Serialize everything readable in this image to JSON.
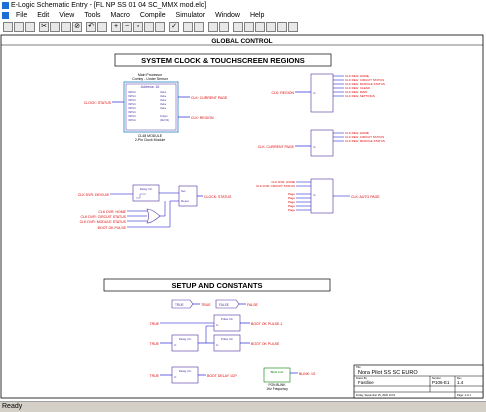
{
  "window": {
    "title": "E-Logic Schematic Entry - [FL NP SS 01 04 SC_MMX mod.elc]"
  },
  "menu": [
    "File",
    "Edit",
    "View",
    "Tools",
    "Macro",
    "Compile",
    "Simulator",
    "Window",
    "Help"
  ],
  "toolbar": {
    "buttons": [
      "new-icon",
      "open-icon",
      "save-icon",
      "cut-icon",
      "copy-icon",
      "paste-icon",
      "delete-icon",
      "undo-icon",
      "print-icon",
      "zoom-in-icon",
      "zoom-out-icon",
      "zoom-fit-icon",
      "window-icon",
      "copy-window-icon",
      "compile-icon",
      "wire-icon",
      "logic-icon",
      "symbol-icon",
      "pin-icon",
      "sim-icon",
      "probe-icon",
      "toggle-icon",
      "relay-icon",
      "gate-icon",
      "chart-icon"
    ]
  },
  "schematic": {
    "frame_title": "GLOBAL CONTROL",
    "section1_title": "SYSTEM CLOCK & TOUCHSCREEN REGIONS",
    "section2_title": "SETUP AND CONSTANTS",
    "clock_module": {
      "header1": "Main Processor",
      "header2": "Comby - Under Sensor",
      "address": "Address: 16",
      "caption1": "CL48 MODULE",
      "caption2": "2-Pin Clock Module"
    },
    "labels": {
      "clk_status": "CLOCK: STATUS",
      "clk_current_page": "CLK: CURRENT PAGE",
      "clk_region": "CLK: REGION",
      "clk_region_b": "CLK: REGION",
      "clk_current_page_b": "CLK: CURRENT PAGE",
      "clock_status_out": "CLOCK: STATUS",
      "clk_dev_div": "CLK DVR: DEV/UIS",
      "clk_dvr_home": "CLK DVR: HOME",
      "clk_dvr_cs": "CLK DVR: CIRCUIT STATUS",
      "clk_dvr_mstat": "CLK DVR: MODULE STATUS",
      "boot_ok": "BOOT OK PULSE",
      "clk_auto_page": "CLK: AUTO PAGE",
      "region_out_1": "CLK REG: HOME",
      "region_out_2": "CLK REG: CIRCUIT STATUS",
      "region_out_3": "CLK REG: MODULE STATUS",
      "region_out_4": "CLK REG: CLEAR",
      "region_out_5": "CLK REG: MAIN",
      "region_out_6": "CLK REG: SETTINGS",
      "page_out_1": "CLK REG: HOME",
      "page_out_2": "CLK REG: CIRCUIT STATUS",
      "page_out_3": "CLK REG: MODULE STATUS"
    },
    "blocks": {
      "delay": "Delay On",
      "set_reset_1": "Set",
      "set_reset_2": "Reset",
      "or_gate": "OR"
    },
    "setup": {
      "true_tag": "TRUE",
      "true_out": "TRUE",
      "false_tag": "FALSE",
      "false_out": "FALSE",
      "true_in1": "TRUE",
      "pulse_1": "Pulse On",
      "boot_pulse_1": "BOOT OK PULSE-1",
      "delay_2": "Delay On",
      "pulse_2": "Pulse On",
      "boot_pulse_2": "BOOT OK PULSE",
      "true_in2": "TRUE",
      "true_in3": "TRUE",
      "delay_3": "Delay On",
      "boot_delay": "BOOT DELAY 1CP",
      "blink": "Blink 1Hz",
      "blink_out": "BLINK: 1S",
      "blink_caption1": "PON BLINK",
      "blink_caption2": "1Hz Frequency"
    },
    "title_block": {
      "project": "Nora Pilot SS SC EURO",
      "drawn": "Fastline",
      "sheet": "P106-E1",
      "rev": "1.4",
      "date": "Friday, September 25, 2020 10:01",
      "page": "Page: 1 of 1"
    }
  },
  "status": {
    "text": "Ready"
  },
  "colors": {
    "wire": "#0000cc",
    "label": "#e00000",
    "block": "#5030a0"
  }
}
